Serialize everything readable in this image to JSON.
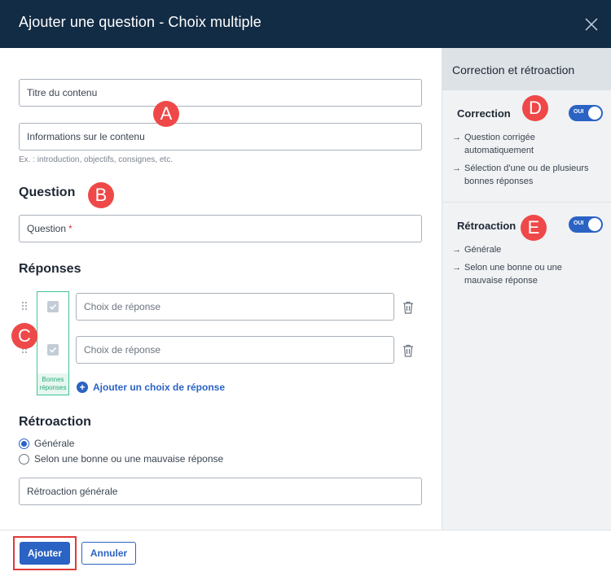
{
  "header": {
    "title": "Ajouter une question - Choix multiple",
    "close_icon": "close-icon"
  },
  "main": {
    "content_title_placeholder": "Titre du contenu",
    "content_info_placeholder": "Informations sur le contenu",
    "content_info_hint": "Ex. : introduction, objectifs, consignes, etc.",
    "question_heading": "Question",
    "question_placeholder": "Question",
    "question_required": "*",
    "answers_heading": "Réponses",
    "answers": [
      {
        "placeholder": "Choix de réponse",
        "correct": true
      },
      {
        "placeholder": "Choix de réponse",
        "correct": true
      }
    ],
    "good_answers_label_1": "Bonnes",
    "good_answers_label_2": "réponses",
    "add_choice_label": "Ajouter un choix de réponse",
    "feedback_heading": "Rétroaction",
    "feedback_options": [
      {
        "label": "Générale",
        "selected": true
      },
      {
        "label": "Selon une bonne ou une mauvaise réponse",
        "selected": false
      }
    ],
    "feedback_placeholder": "Rétroaction générale"
  },
  "side": {
    "title": "Correction et rétroaction",
    "correction": {
      "label": "Correction",
      "toggle": "OUI",
      "items": [
        "Question corrigée automatiquement",
        "Sélection d'une ou de plusieurs bonnes réponses"
      ]
    },
    "feedback": {
      "label": "Rétroaction",
      "toggle": "OUI",
      "items": [
        "Générale",
        "Selon une bonne ou une mauvaise réponse"
      ]
    },
    "arrow": "→"
  },
  "markers": {
    "a": "A",
    "b": "B",
    "c": "C",
    "d": "D",
    "e": "E"
  },
  "footer": {
    "add_label": "Ajouter",
    "cancel_label": "Annuler"
  },
  "colors": {
    "header_bg": "#132c45",
    "accent": "#2b63c4",
    "marker": "#ef4848",
    "correct_border": "#41c49a"
  }
}
